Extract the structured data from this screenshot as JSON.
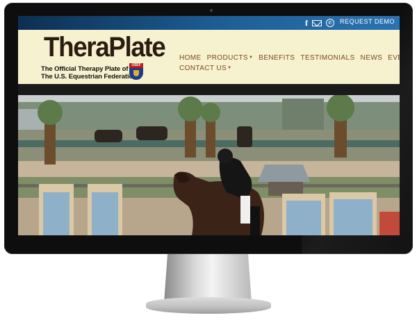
{
  "topbar": {
    "icons": [
      "facebook-icon",
      "mail-icon",
      "phone-icon"
    ],
    "facebook_glyph": "f",
    "request_demo": "REQUEST DEMO"
  },
  "logo": {
    "title": "TheraPlate",
    "subtitle_line1": "The Official Therapy Plate of",
    "subtitle_line2": "The U.S. Equestrian Federation",
    "badge_text": "USEF"
  },
  "nav": {
    "items": [
      {
        "label": "HOME",
        "dropdown": false
      },
      {
        "label": "PRODUCTS",
        "dropdown": true
      },
      {
        "label": "BENEFITS",
        "dropdown": false
      },
      {
        "label": "TESTIMONIALS",
        "dropdown": false
      },
      {
        "label": "NEWS",
        "dropdown": false
      },
      {
        "label": "EVENTS",
        "dropdown": false
      },
      {
        "label": "CONTACT US",
        "dropdown": true
      }
    ]
  },
  "hero": {
    "description_hidden": ""
  },
  "colors": {
    "topbar_left": "#0c2f52",
    "topbar_right": "#2a73b0",
    "header_bg": "#f6f1cf",
    "nav_text": "#7a4b1e",
    "logo_text": "#2a1c10"
  }
}
